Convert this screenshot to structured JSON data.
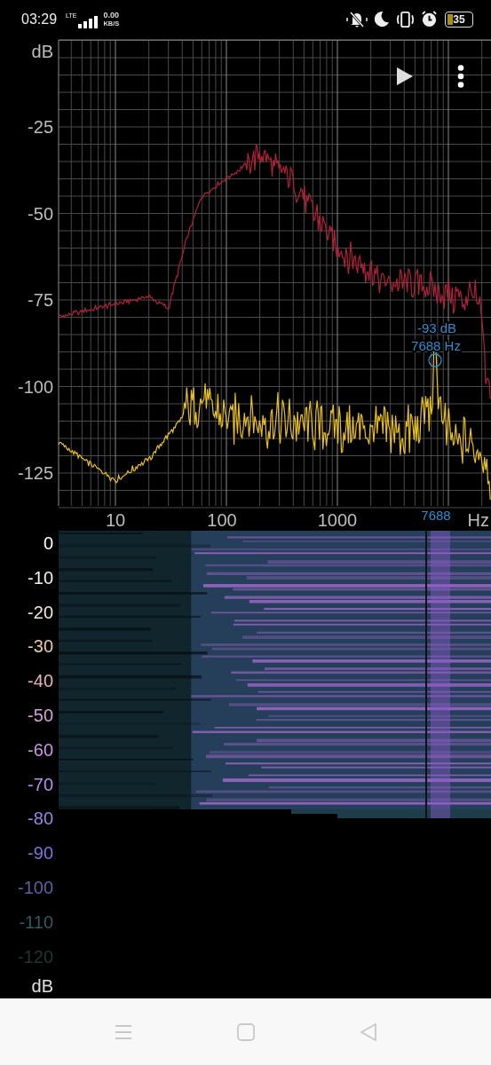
{
  "status_bar": {
    "time": "03:29",
    "network": "LTE",
    "speed_value": "0.00",
    "speed_unit": "KB/S",
    "battery": "35"
  },
  "spectrum": {
    "y_unit": "dB",
    "y_labels": [
      "-25",
      "-50",
      "-75",
      "-100",
      "-125"
    ],
    "x_labels": [
      "10",
      "100",
      "1000"
    ],
    "x_unit": "Hz",
    "peak": {
      "level_text": "-93 dB",
      "freq_text": "7688 Hz",
      "axis_marker": "7688"
    }
  },
  "spectrogram": {
    "unit": "dB",
    "labels": [
      {
        "text": "0",
        "color": "#ffffff"
      },
      {
        "text": "-10",
        "color": "#f0f0f0"
      },
      {
        "text": "-20",
        "color": "#f2e6d8"
      },
      {
        "text": "-30",
        "color": "#f0c8a8"
      },
      {
        "text": "-40",
        "color": "#e8b0c0"
      },
      {
        "text": "-50",
        "color": "#d8a0d8"
      },
      {
        "text": "-60",
        "color": "#c898e0"
      },
      {
        "text": "-70",
        "color": "#b890e8"
      },
      {
        "text": "-80",
        "color": "#a080e0"
      },
      {
        "text": "-90",
        "color": "#8070d8"
      },
      {
        "text": "-100",
        "color": "#5a60a0"
      },
      {
        "text": "-110",
        "color": "#2e5a60"
      },
      {
        "text": "-120",
        "color": "#1c3a2c"
      }
    ]
  }
}
